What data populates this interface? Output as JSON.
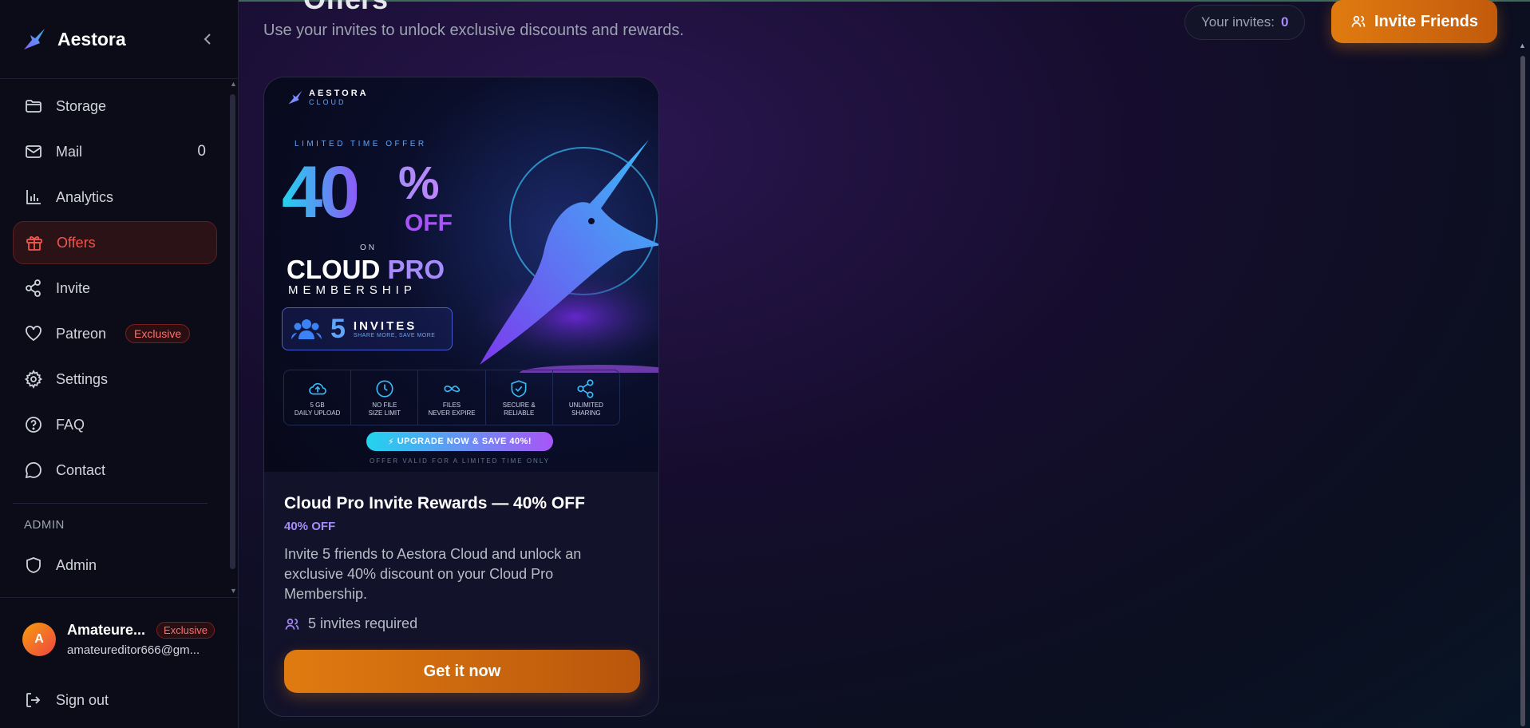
{
  "app": {
    "name": "Aestora"
  },
  "sidebar": {
    "items": [
      {
        "label": "Storage",
        "icon": "folder-icon"
      },
      {
        "label": "Mail",
        "icon": "mail-icon",
        "count": "0"
      },
      {
        "label": "Analytics",
        "icon": "bar-chart-icon"
      },
      {
        "label": "Offers",
        "icon": "gift-icon",
        "active": true
      },
      {
        "label": "Invite",
        "icon": "share-icon"
      },
      {
        "label": "Patreon",
        "icon": "heart-icon",
        "badge": "Exclusive"
      },
      {
        "label": "Settings",
        "icon": "gear-icon"
      },
      {
        "label": "FAQ",
        "icon": "help-circle-icon"
      },
      {
        "label": "Contact",
        "icon": "message-circle-icon"
      }
    ],
    "section_admin": "ADMIN",
    "admin_item": {
      "label": "Admin",
      "icon": "shield-icon"
    },
    "user": {
      "initial": "A",
      "name": "Amateure...",
      "badge": "Exclusive",
      "email": "amateureditor666@gm..."
    },
    "signout": "Sign out"
  },
  "header": {
    "title": "Offers",
    "subtitle": "Use your invites to unlock exclusive discounts and rewards.",
    "invites_label": "Your invites:",
    "invites_count": "0",
    "invite_button": "Invite Friends"
  },
  "offer": {
    "banner": {
      "brand": "AESTORA",
      "brand_sub": "CLOUD",
      "limited": "LIMITED TIME OFFER",
      "percent": "40",
      "percent_sign": "%",
      "off": "OFF",
      "on": "ON",
      "cloud": "CLOUD",
      "pro": "PRO",
      "membership": "MEMBERSHIP",
      "invites_num": "5",
      "invites_word": "INVITES",
      "invites_tag": "SHARE MORE, SAVE MORE",
      "features": [
        {
          "icon": "cloud-upload-icon",
          "line1": "5 GB",
          "line2": "DAILY UPLOAD"
        },
        {
          "icon": "clock-icon",
          "line1": "NO FILE",
          "line2": "SIZE LIMIT"
        },
        {
          "icon": "infinity-icon",
          "line1": "FILES",
          "line2": "NEVER EXPIRE"
        },
        {
          "icon": "shield-check-icon",
          "line1": "SECURE &",
          "line2": "RELIABLE"
        },
        {
          "icon": "share-icon",
          "line1": "UNLIMITED",
          "line2": "SHARING"
        }
      ],
      "upgrade": "UPGRADE NOW & SAVE 40%!",
      "valid": "OFFER VALID FOR A LIMITED TIME ONLY"
    },
    "title": "Cloud Pro Invite Rewards — 40% OFF",
    "tag": "40% OFF",
    "description": "Invite 5 friends to Aestora Cloud and unlock an exclusive 40% discount on your Cloud Pro Membership.",
    "requirement": "5 invites required",
    "cta": "Get it now"
  },
  "colors": {
    "accent_orange": "#e07b10",
    "active_red": "#f2564d",
    "purple": "#a78bfa"
  }
}
